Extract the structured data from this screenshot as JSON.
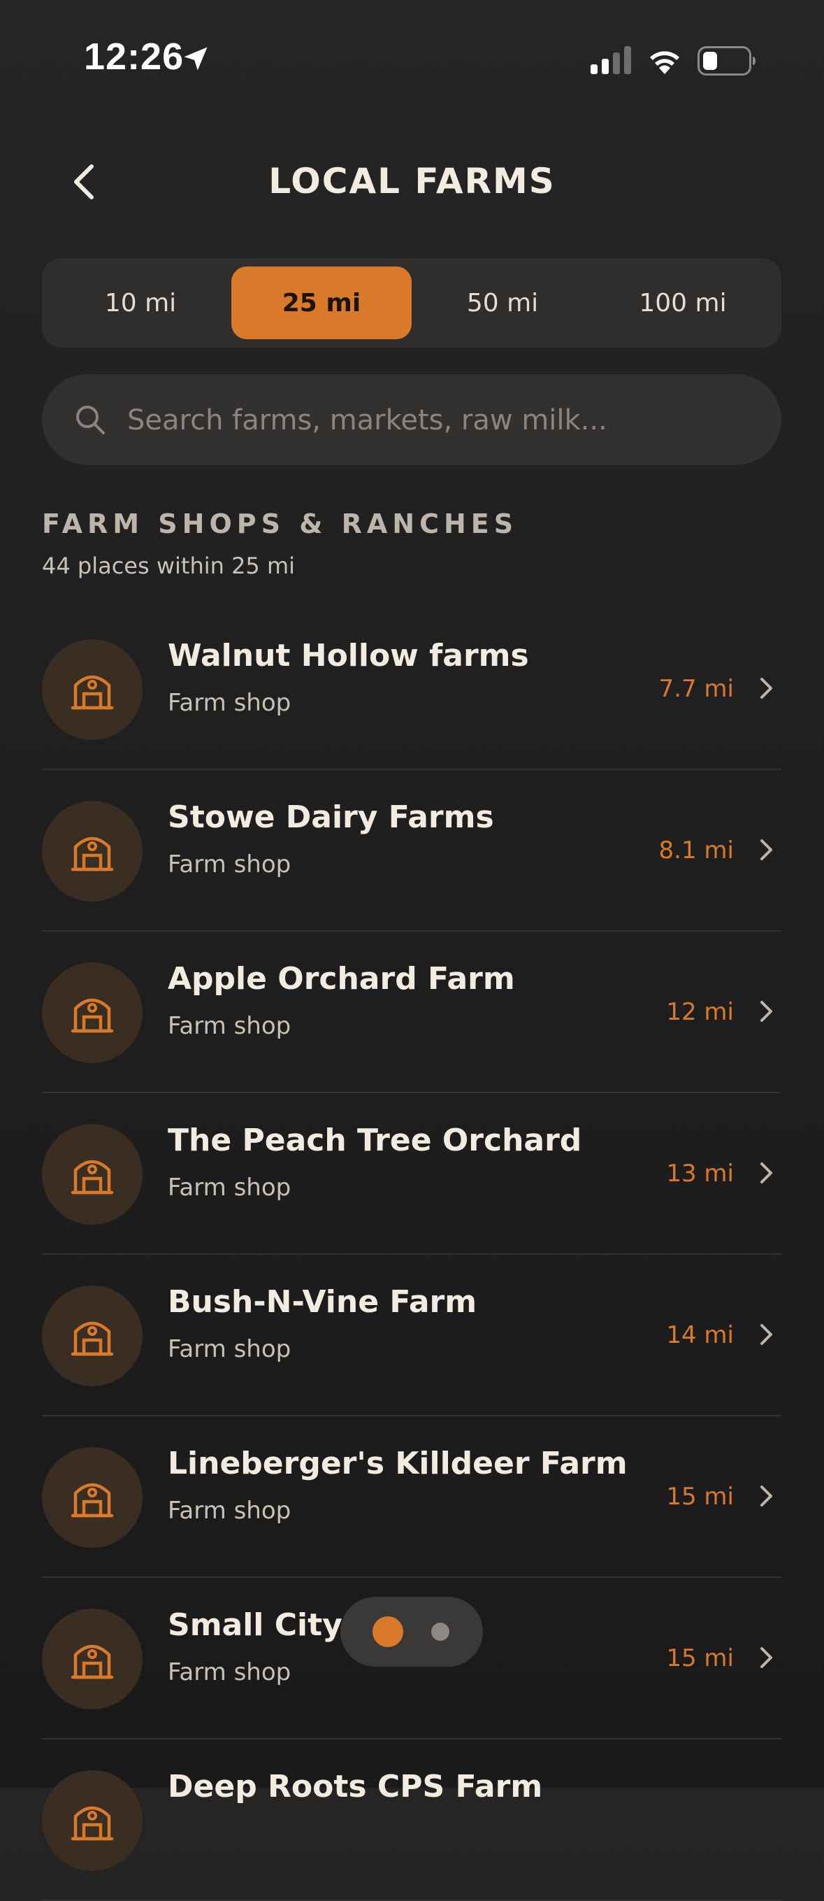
{
  "status_bar": {
    "time": "12:26"
  },
  "header": {
    "title": "LOCAL FARMS"
  },
  "distance_filter": {
    "options": [
      "10 mi",
      "25 mi",
      "50 mi",
      "100 mi"
    ],
    "selected": "25 mi"
  },
  "search": {
    "placeholder": "Search farms, markets, raw milk..."
  },
  "section": {
    "title": "FARM SHOPS & RANCHES",
    "subtitle": "44 places within 25 mi"
  },
  "places": [
    {
      "name": "Walnut Hollow farms",
      "type": "Farm shop",
      "distance": "7.7 mi"
    },
    {
      "name": "Stowe Dairy Farms",
      "type": "Farm shop",
      "distance": "8.1 mi"
    },
    {
      "name": "Apple Orchard Farm",
      "type": "Farm shop",
      "distance": "12 mi"
    },
    {
      "name": "The Peach Tree Orchard",
      "type": "Farm shop",
      "distance": "13 mi"
    },
    {
      "name": "Bush-N-Vine Farm",
      "type": "Farm shop",
      "distance": "14 mi"
    },
    {
      "name": "Lineberger's Killdeer Farm",
      "type": "Farm shop",
      "distance": "15 mi"
    },
    {
      "name": "Small City F    A",
      "type": "Farm shop",
      "distance": "15 mi"
    },
    {
      "name": "Deep Roots CPS Farm",
      "type": "",
      "distance": ""
    }
  ],
  "colors": {
    "accent": "#d97a2b",
    "background": "#1f1f1f",
    "text": "#f2ebe0"
  },
  "icons": {
    "back": "chevron-left-icon",
    "search": "search-icon",
    "place": "barn-icon",
    "row_action": "chevron-right-icon"
  }
}
